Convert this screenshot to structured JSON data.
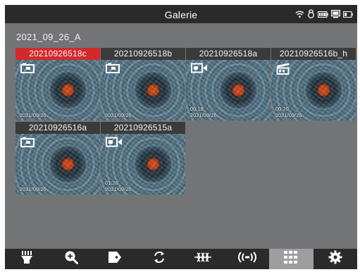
{
  "header": {
    "title": "Galerie"
  },
  "folder": {
    "name": "2021_09_26_A"
  },
  "tiles": [
    {
      "name": "20210926518c",
      "type": "photo",
      "duration": "",
      "date": "2021/09/26",
      "selected": true
    },
    {
      "name": "20210926518b",
      "type": "photo",
      "duration": "",
      "date": "2021/09/26",
      "selected": false
    },
    {
      "name": "20210926518a",
      "type": "video",
      "duration": "00:18",
      "date": "2021/09/26",
      "selected": false
    },
    {
      "name": "20210926516b_h",
      "type": "clapper",
      "duration": "00:20",
      "date": "2021/09/26",
      "selected": false
    },
    {
      "name": "20210926516a",
      "type": "photo",
      "duration": "",
      "date": "2021/09/26",
      "selected": false
    },
    {
      "name": "20210926515a",
      "type": "video",
      "duration": "01:20",
      "date": "2021/09/26",
      "selected": false
    }
  ],
  "status_icons": [
    "wifi-icon",
    "lock-icon",
    "battery-icon",
    "monitor-icon",
    "battery-small-icon"
  ],
  "toolbar": [
    "light-icon",
    "zoom-in-icon",
    "tag-icon",
    "rotate-icon",
    "filter-icon",
    "stream-icon",
    "grid-icon",
    "settings-icon"
  ],
  "colors": {
    "selected": "#d3292b",
    "bar": "#2a2a2b",
    "background": "#727476",
    "active_tab": "#9e9ea0"
  }
}
